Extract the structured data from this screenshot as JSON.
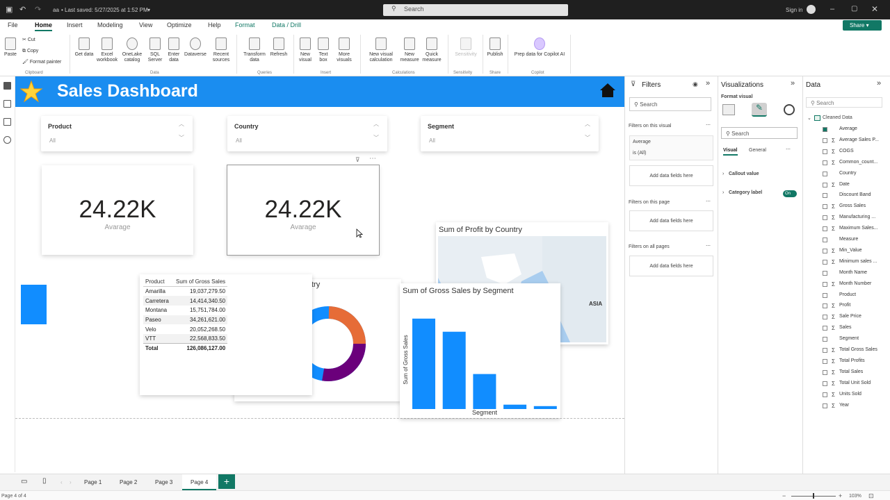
{
  "titlebar": {
    "file_name": "aa",
    "saved_text": "• Last saved: 5/27/2025 at 1:52 PM",
    "search_placeholder": "Search",
    "signin": "Sign in"
  },
  "menu": [
    "File",
    "Home",
    "Insert",
    "Modeling",
    "View",
    "Optimize",
    "Help",
    "Format",
    "Data / Drill"
  ],
  "share_label": "Share",
  "ribbon": {
    "paste": "Paste",
    "cut": "Cut",
    "copy": "Copy",
    "format_painter": "Format painter",
    "get_data": "Get data",
    "excel": "Excel workbook",
    "onelake": "OneLake catalog",
    "sql": "SQL Server",
    "enter_data": "Enter data",
    "dataverse": "Dataverse",
    "recent": "Recent sources",
    "transform": "Transform data",
    "refresh": "Refresh",
    "new_visual": "New visual",
    "text_box": "Text box",
    "more_visuals": "More visuals",
    "new_visual_calc": "New visual calculation",
    "new_measure": "New measure",
    "quick_measure": "Quick measure",
    "sensitivity": "Sensitivity",
    "publish": "Publish",
    "copilot": "Prep data for Copilot AI",
    "groups": [
      "Clipboard",
      "Data",
      "Queries",
      "Insert",
      "Calculations",
      "Sensitivity",
      "Share",
      "Copilot"
    ]
  },
  "report": {
    "title": "Sales Dashboard",
    "slicers": [
      {
        "label": "Product",
        "value": "All"
      },
      {
        "label": "Country",
        "value": "All"
      },
      {
        "label": "Segment",
        "value": "All"
      }
    ],
    "cards": [
      {
        "value": "24.22K",
        "label": "Avarage"
      },
      {
        "value": "24.22K",
        "label": "Avarage"
      }
    ],
    "map": {
      "title": "Sum of Profit by Country",
      "region_label": "ASIA"
    },
    "donut": {
      "title_fragment": "try"
    },
    "table": {
      "headers": [
        "Product",
        "Sum of Gross Sales"
      ],
      "rows": [
        [
          "Amarilla",
          "19,037,279.50"
        ],
        [
          "Carretera",
          "14,414,340.50"
        ],
        [
          "Montana",
          "15,751,784.00"
        ],
        [
          "Paseo",
          "34,261,621.00"
        ],
        [
          "Velo",
          "20,052,268.50"
        ],
        [
          "VTT",
          "22,568,833.50"
        ]
      ],
      "total_label": "Total",
      "total_value": "126,086,127.00"
    }
  },
  "chart_data": {
    "type": "bar",
    "title": "Sum of Gross Sales by Segment",
    "xlabel": "Segment",
    "ylabel": "Sum of Gross Sales",
    "categories": [
      "",
      "",
      "",
      "",
      ""
    ],
    "values": [
      62,
      53,
      24,
      3,
      2
    ],
    "ylim": [
      0,
      70
    ],
    "color": "#118dff"
  },
  "filters": {
    "title": "Filters",
    "search": "Search",
    "on_visual": "Filters on this visual",
    "filter_name": "Average",
    "filter_value": "is (All)",
    "add": "Add data fields here",
    "on_page": "Filters on this page",
    "on_all": "Filters on all pages"
  },
  "viz": {
    "title": "Visualizations",
    "format_visual": "Format visual",
    "search": "Search",
    "tab_visual": "Visual",
    "tab_general": "General",
    "callout": "Callout value",
    "category": "Category label",
    "toggle": "On"
  },
  "data": {
    "title": "Data",
    "search": "Search",
    "table_name": "Cleaned Data",
    "fields": [
      "Average",
      "Average Sales P...",
      "COGS",
      "Common_count...",
      "Country",
      "Date",
      "Discount Band",
      "Gross Sales",
      "Manufacturing ...",
      "Maximum Sales...",
      "Measure",
      "Min_Value",
      "Minimum sales ...",
      "Month Name",
      "Month Number",
      "Product",
      "Profit",
      "Sale Price",
      "Sales",
      "Segment",
      "Total Gross Sales",
      "Total Profits",
      "Total Sales",
      "Total Unit Sold",
      "Units Sold",
      "Year"
    ]
  },
  "pages": [
    "Page 1",
    "Page 2",
    "Page 3",
    "Page 4"
  ],
  "status": {
    "page": "Page 4 of 4",
    "zoom": "103%"
  }
}
